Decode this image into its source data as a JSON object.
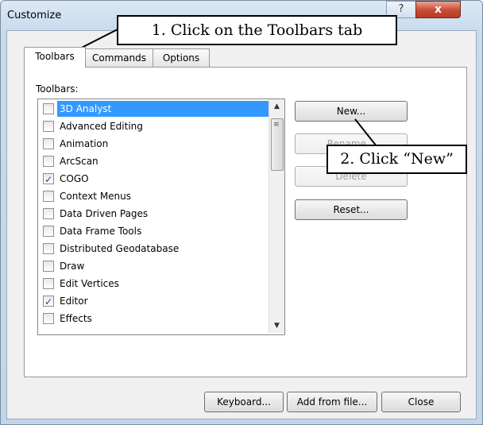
{
  "window": {
    "title": "Customize",
    "help": "?",
    "close": "x"
  },
  "tabs": [
    "Toolbars",
    "Commands",
    "Options"
  ],
  "toolbars_label": "Toolbars:",
  "toolbar_items": [
    {
      "label": "3D Analyst",
      "checked": false,
      "selected": true
    },
    {
      "label": "Advanced Editing",
      "checked": false
    },
    {
      "label": "Animation",
      "checked": false
    },
    {
      "label": "ArcScan",
      "checked": false
    },
    {
      "label": "COGO",
      "checked": true
    },
    {
      "label": "Context Menus",
      "checked": false
    },
    {
      "label": "Data Driven Pages",
      "checked": false
    },
    {
      "label": "Data Frame Tools",
      "checked": false
    },
    {
      "label": "Distributed Geodatabase",
      "checked": false
    },
    {
      "label": "Draw",
      "checked": false
    },
    {
      "label": "Edit Vertices",
      "checked": false
    },
    {
      "label": "Editor",
      "checked": true
    },
    {
      "label": "Effects",
      "checked": false
    }
  ],
  "side_buttons": {
    "new": "New...",
    "rename": "Rename...",
    "delete": "Delete",
    "reset": "Reset..."
  },
  "bottom_buttons": {
    "keyboard": "Keyboard...",
    "add_from_file": "Add from file...",
    "close": "Close"
  },
  "callouts": {
    "tab": "1. Click on the Toolbars tab",
    "new": "2. Click “New”"
  }
}
